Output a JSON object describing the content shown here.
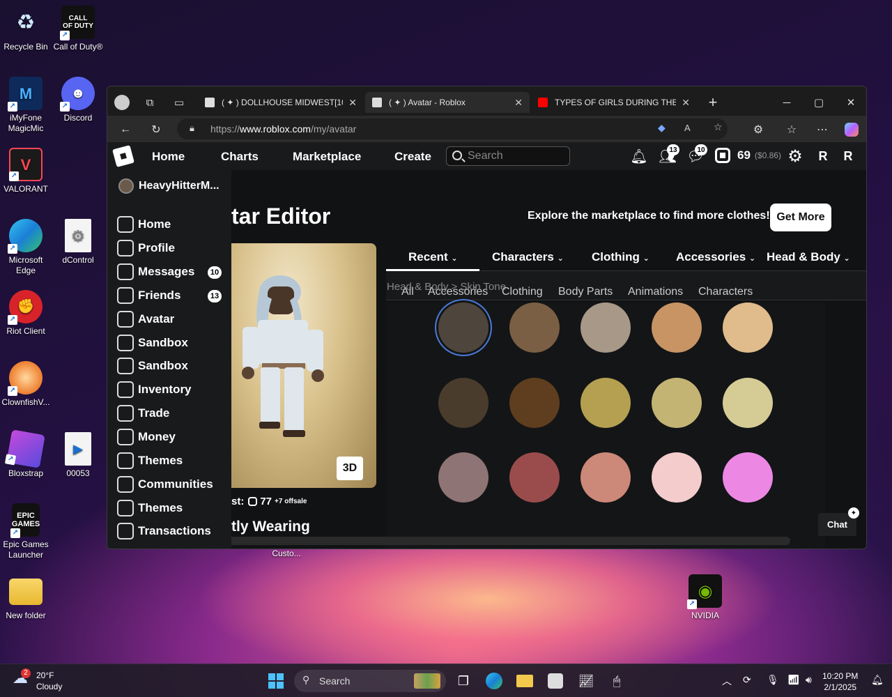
{
  "desktop_icons": [
    {
      "label": "Recycle Bin",
      "icon": "recycle-bin-icon"
    },
    {
      "label": "Call of Duty®",
      "icon": "call-of-duty-icon",
      "logo_text": "CALL OF DUTY"
    },
    {
      "label": "iMyFone MagicMic",
      "icon": "imyfone-icon"
    },
    {
      "label": "Discord",
      "icon": "discord-icon"
    },
    {
      "label": "VALORANT",
      "icon": "valorant-icon"
    },
    {
      "label": "Microsoft Edge",
      "icon": "edge-icon"
    },
    {
      "label": "dControl",
      "icon": "dcontrol-icon"
    },
    {
      "label": "Riot Client",
      "icon": "riot-client-icon"
    },
    {
      "label": "ClownfishV...",
      "icon": "clownfish-icon"
    },
    {
      "label": "Bloxstrap",
      "icon": "bloxstrap-icon"
    },
    {
      "label": "00053",
      "icon": "video-file-icon"
    },
    {
      "label": "Epic Games Launcher",
      "icon": "epic-games-icon",
      "logo_text": "EPIC GAMES"
    },
    {
      "label": "New folder",
      "icon": "folder-icon"
    },
    {
      "label": "Custo...",
      "icon": "custom-icon"
    },
    {
      "label": "NVIDIA",
      "icon": "nvidia-icon"
    }
  ],
  "browser": {
    "tabs": [
      {
        "title": "( ✦ ) DOLLHOUSE MIDWEST[100K",
        "active": false
      },
      {
        "title": "( ✦ ) Avatar - Roblox",
        "active": true
      },
      {
        "title": "TYPES OF GIRLS DURING THE SU",
        "active": false
      }
    ],
    "url_prefix": "https://",
    "url_host": "www.roblox.com",
    "url_path": "/my/avatar"
  },
  "roblox": {
    "nav": {
      "links": [
        "Home",
        "Charts",
        "Marketplace",
        "Create"
      ],
      "search_placeholder": "Search",
      "friends_badge": "13",
      "messages_badge": "10",
      "robux": "69",
      "robux_usd": "($0.86)"
    },
    "sidebar": {
      "username": "HeavyHitterM...",
      "items": [
        {
          "label": "Home",
          "icon": "home-icon",
          "count": ""
        },
        {
          "label": "Profile",
          "icon": "profile-icon",
          "count": ""
        },
        {
          "label": "Messages",
          "icon": "messages-icon",
          "count": "10"
        },
        {
          "label": "Friends",
          "icon": "friends-icon",
          "count": "13"
        },
        {
          "label": "Avatar",
          "icon": "avatar-icon",
          "count": ""
        },
        {
          "label": "Sandbox",
          "icon": "sandbox-icon",
          "count": ""
        },
        {
          "label": "Sandbox",
          "icon": "sandbox-icon",
          "count": ""
        },
        {
          "label": "Inventory",
          "icon": "inventory-icon",
          "count": ""
        },
        {
          "label": "Trade",
          "icon": "trade-icon",
          "count": ""
        },
        {
          "label": "Money",
          "icon": "money-icon",
          "count": ""
        },
        {
          "label": "Themes",
          "icon": "themes-icon",
          "count": ""
        },
        {
          "label": "Communities",
          "icon": "communities-icon",
          "count": ""
        },
        {
          "label": "Themes",
          "icon": "themes-icon",
          "count": ""
        },
        {
          "label": "Transactions",
          "icon": "transactions-icon",
          "count": ""
        }
      ]
    },
    "editor": {
      "title": "tar Editor",
      "explore_text": "Explore the marketplace to find more clothes!",
      "get_more": "Get More",
      "view_3d": "3D",
      "cost_label": "st:",
      "cost_value": "77",
      "offsale": "+7 offsale",
      "wearing": "tly Wearing",
      "categories": [
        "Recent",
        "Characters",
        "Clothing",
        "Accessories",
        "Head & Body"
      ],
      "subcategories": [
        "All",
        "Accessories",
        "Clothing",
        "Body Parts",
        "Animations",
        "Characters"
      ],
      "breadcrumb": "Head & Body > Skin Tone",
      "skin_tones": [
        "#4e463c",
        "#7a5f44",
        "#a89888",
        "#c89464",
        "#e0bc8c",
        "#4a3c2c",
        "#5e3e1e",
        "#b4a050",
        "#c4b474",
        "#d4cc94",
        "#8e7474",
        "#9a4c4c",
        "#cc8878",
        "#f4cccc",
        "#ec88e4"
      ],
      "selected_index": 0,
      "chat_label": "Chat"
    }
  },
  "taskbar": {
    "weather_badge": "2",
    "temp": "20°F",
    "condition": "Cloudy",
    "search_placeholder": "Search",
    "time": "10:20 PM",
    "date": "2/1/2025"
  }
}
